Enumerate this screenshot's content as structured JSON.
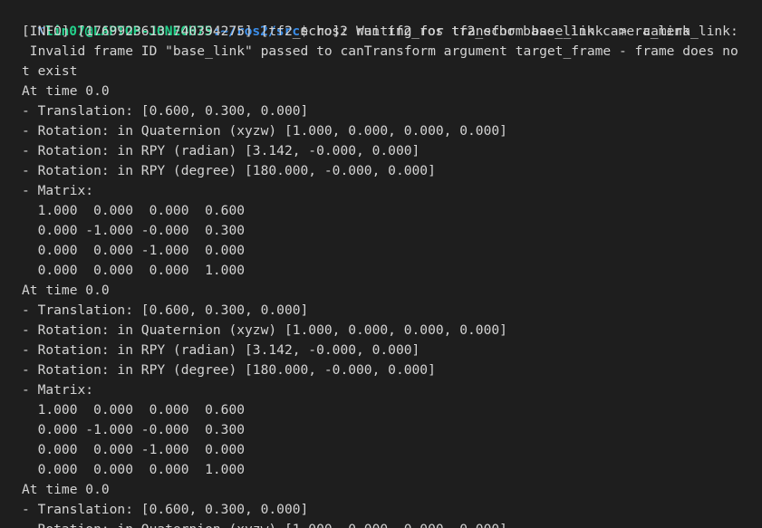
{
  "terminal": {
    "prompt": {
      "icon": "⌥",
      "user_host": "lin07@LAPTOP-JONEOH75",
      "path": ":~/ros2/src",
      "dollar": "$",
      "command": " ros2 run tf2_ros tf2_echo base_link camera_link"
    },
    "output": [
      "[INFO] [1769923613.740394275] [tf2_echo]: Waiting for transform base_link ->  camera_link:",
      " Invalid frame ID \"base_link\" passed to canTransform argument target_frame - frame does no",
      "t exist",
      "At time 0.0",
      "- Translation: [0.600, 0.300, 0.000]",
      "- Rotation: in Quaternion (xyzw) [1.000, 0.000, 0.000, 0.000]",
      "- Rotation: in RPY (radian) [3.142, -0.000, 0.000]",
      "- Rotation: in RPY (degree) [180.000, -0.000, 0.000]",
      "- Matrix:",
      "  1.000  0.000  0.000  0.600",
      "  0.000 -1.000 -0.000  0.300",
      "  0.000  0.000 -1.000  0.000",
      "  0.000  0.000  0.000  1.000",
      "At time 0.0",
      "- Translation: [0.600, 0.300, 0.000]",
      "- Rotation: in Quaternion (xyzw) [1.000, 0.000, 0.000, 0.000]",
      "- Rotation: in RPY (radian) [3.142, -0.000, 0.000]",
      "- Rotation: in RPY (degree) [180.000, -0.000, 0.000]",
      "- Matrix:",
      "  1.000  0.000  0.000  0.600",
      "  0.000 -1.000 -0.000  0.300",
      "  0.000  0.000 -1.000  0.000",
      "  0.000  0.000  0.000  1.000",
      "At time 0.0",
      "- Translation: [0.600, 0.300, 0.000]",
      "- Rotation: in Quaternion (xyzw) [1.000, 0.000, 0.000, 0.000]"
    ]
  },
  "colors": {
    "background": "#1e1e1e",
    "text": "#d4d4d4",
    "user_host": "#23d18b",
    "path": "#3b8eea"
  }
}
